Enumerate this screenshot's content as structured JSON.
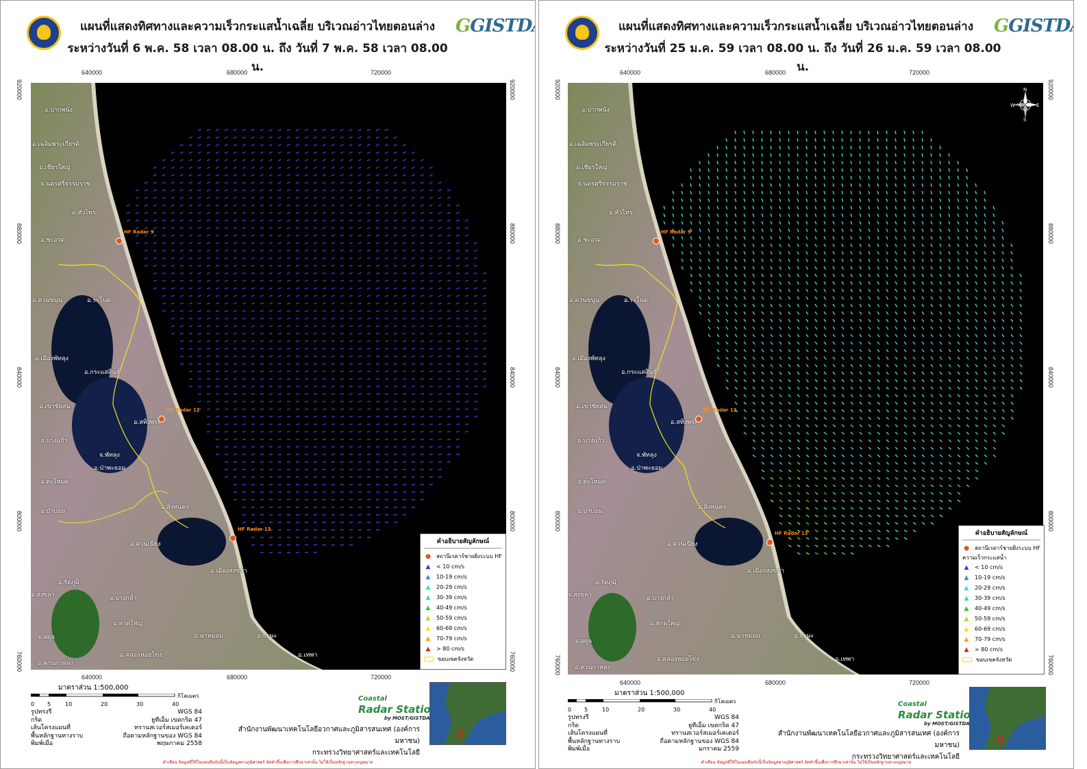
{
  "left": {
    "title_line1": "แผนที่แสดงทิศทางและความเร็วกระแสน้ำเฉลี่ย บริเวณอ่าวไทยตอนล่าง",
    "title_line2": "ระหว่างวันที่ 6 พ.ค. 58 เวลา 08.00 น. ถึง วันที่ 7 พ.ค. 58 เวลา 08.00 น.",
    "print_date": "พฤษภาคม 2558",
    "vector_color": "#3a3fd6",
    "legend_title": "คำอธิบายสัญลักษณ์",
    "speed_subtitle": ""
  },
  "right": {
    "title_line1": "แผนที่แสดงทิศทางและความเร็วกระแสน้ำเฉลี่ย บริเวณอ่าวไทยตอนล่าง",
    "title_line2": "ระหว่างวันที่ 25 ม.ค. 59 เวลา 08.00 น. ถึง วันที่ 26 ม.ค. 59 เวลา 08.00 น.",
    "print_date": "มกราคม 2559",
    "vector_color": "#40d9c9",
    "legend_title": "คำอธิบายสัญลักษณ์",
    "speed_subtitle": "ความเร็วกระแสน้ำ"
  },
  "logo": {
    "gistda": "GISTDA",
    "crs_line1": "Coastal",
    "crs_line2": "Radar Station",
    "crs_line3": "by MOST/GISTDA"
  },
  "axis": {
    "x_ticks": [
      "640000",
      "680000",
      "720000"
    ],
    "y_ticks": [
      "920000",
      "880000",
      "840000",
      "800000",
      "760000"
    ]
  },
  "legend": {
    "station": "สถานีเรดาร์ชายฝั่งระบบ HF",
    "boundary": "ขอบเขตจังหวัด",
    "classes": [
      {
        "label": "< 10 cm/s",
        "color": "#3a3fd6"
      },
      {
        "label": "10-19 cm/s",
        "color": "#3b8fe0"
      },
      {
        "label": "20-29 cm/s",
        "color": "#40d9c9"
      },
      {
        "label": "30-39 cm/s",
        "color": "#3fe08a"
      },
      {
        "label": "40-49 cm/s",
        "color": "#38c928"
      },
      {
        "label": "50-59 cm/s",
        "color": "#a7e021"
      },
      {
        "label": "60-69 cm/s",
        "color": "#f2e11d"
      },
      {
        "label": "70-79 cm/s",
        "color": "#f2a51d"
      },
      {
        "label": "> 80 cm/s",
        "color": "#e0221d"
      }
    ]
  },
  "scale": {
    "title": "มาตราส่วน 1:500,000",
    "ticks": [
      "0",
      "5",
      "10",
      "20",
      "30",
      "40"
    ],
    "unit": "กิโลเมตร"
  },
  "info": [
    {
      "k": "รูปทรงรี",
      "v": "WGS 84"
    },
    {
      "k": "กริด",
      "v": "ยูทีเอ็ม เขตกริด 47"
    },
    {
      "k": "เส้นโครงแผนที่",
      "v": "ทรานสเวอร์สเมอร์เคเตอร์"
    },
    {
      "k": "พื้นหลักฐานทางราบ",
      "v": "ถือตามหลักฐานของ WGS 84"
    },
    {
      "k": "พิมพ์เมื่อ",
      "v": ""
    }
  ],
  "org_line1": "สำนักงานพัฒนาเทคโนโลยีอวกาศและภูมิสารสนเทศ (องค์การมหาชน)",
  "org_line2": "กระทรวงวิทยาศาสตร์และเทคโนโลยี",
  "footnote": "คำเตือน ข้อมูลที่ใช้ในแผนที่ฉบับนี้เป็นข้อมูลทางภูมิศาสตร์ จัดทำขึ้นเพื่อการศึกษาเท่านั้น ไม่ใช้เป็นหลักฐานทางกฎหมาย",
  "places": [
    "อ.ปากพนัง",
    "อ.เฉลิมพระเกียรติ",
    "อ.เชียรใหญ่",
    "จ.นครศรีธรรมราช",
    "อ.หัวไทร",
    "อ.ชะอวด",
    "อ.ควนขนุน",
    "อ.ระโนด",
    "อ.เมืองพัทลุง",
    "อ.กระแสสินธุ์",
    "อ.เขาชัยสน",
    "อ.สทิงพระ",
    "อ.บางแก้ว",
    "จ.พัทลุง",
    "อ.ป่าพะยอม",
    "อ.ตะโหมด",
    "อ.ป่าบอน",
    "อ.สิงหนคร",
    "อ.ควนเนียง",
    "อ.เมืองสงขลา",
    "อ.รัตภูมิ",
    "จ.สงขลา",
    "อ.บางกล่ำ",
    "อ.หาดใหญ่",
    "อ.นาหม่อม",
    "อ.จะนะ",
    "จ.สตูล",
    "อ.ควนกาหลง",
    "อ.คลองหอยโข่ง",
    "อ.เทพา"
  ],
  "radars": [
    "HF Radar 9",
    "HF Radar 12",
    "HF Radar 13"
  ],
  "compass": {
    "n": "N",
    "s": "S",
    "e": "E",
    "w": "W"
  }
}
